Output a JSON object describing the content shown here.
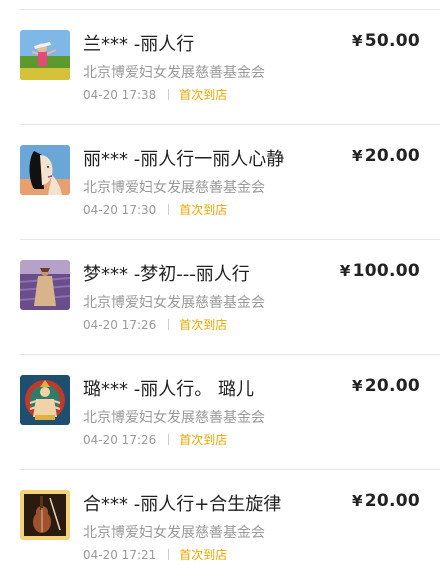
{
  "currency_symbol": "¥",
  "items": [
    {
      "name": "兰*** -丽人行",
      "amount": "50.00",
      "org": "北京博爱妇女发展慈善基金会",
      "time": "04-20 17:38",
      "tag": "首次到店",
      "avatar_icon": "girl-in-field-photo"
    },
    {
      "name": "丽*** -丽人行一丽人心静",
      "amount": "20.00",
      "org": "北京博爱妇女发展慈善基金会",
      "time": "04-20 17:30",
      "tag": "首次到店",
      "avatar_icon": "woman-portrait-illustration"
    },
    {
      "name": "梦*** -梦初---丽人行",
      "amount": "100.00",
      "org": "北京博爱妇女发展慈善基金会",
      "time": "04-20 17:26",
      "tag": "首次到店",
      "avatar_icon": "woman-in-lavender-field-photo"
    },
    {
      "name": "璐*** -丽人行。 璐儿",
      "amount": "20.00",
      "org": "北京博爱妇女发展慈善基金会",
      "time": "04-20 17:26",
      "tag": "首次到店",
      "avatar_icon": "thangka-deity-painting"
    },
    {
      "name": "合*** -丽人行+合生旋律",
      "amount": "20.00",
      "org": "北京博爱妇女发展慈善基金会",
      "time": "04-20 17:21",
      "tag": "首次到店",
      "avatar_icon": "violin-photo"
    }
  ]
}
